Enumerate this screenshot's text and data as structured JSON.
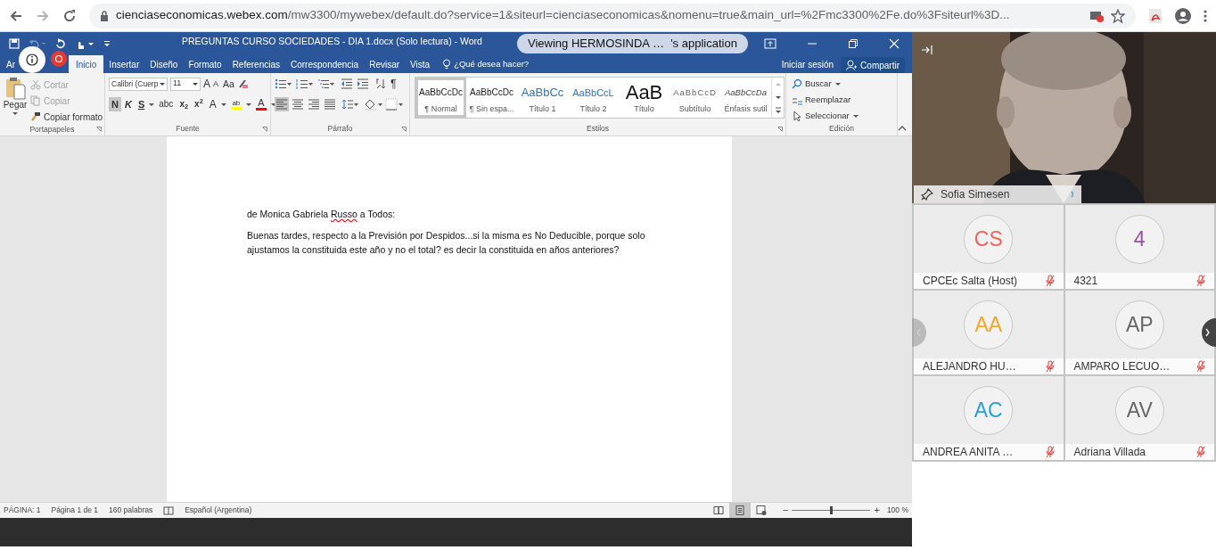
{
  "browser": {
    "host": "cienciaseconomicas.webex.com",
    "path": "/mw3300/mywebex/default.do?service=1&siteurl=cienciaseconomicas&nomenu=true&main_url=%2Fmc3300%2Fe.do%3Fsiteurl%3D..."
  },
  "word": {
    "title": "PREGUNTAS CURSO SOCIEDADES - DIA 1.docx (Solo lectura) - Word",
    "tabs": [
      {
        "label": "Ar",
        "selected": false
      },
      {
        "label": "Inicio",
        "selected": true
      },
      {
        "label": "Insertar",
        "selected": false
      },
      {
        "label": "Diseño",
        "selected": false
      },
      {
        "label": "Formato",
        "selected": false
      },
      {
        "label": "Referencias",
        "selected": false
      },
      {
        "label": "Correspondencia",
        "selected": false
      },
      {
        "label": "Revisar",
        "selected": false
      },
      {
        "label": "Vista",
        "selected": false
      }
    ],
    "tell_me": "¿Qué desea hacer?",
    "account": "Iniciar sesión",
    "share": "Compartir",
    "clipboard": {
      "group": "Portapapeles",
      "paste": "Pegar",
      "items": [
        {
          "kind": "cut",
          "label": "Cortar",
          "disabled": true
        },
        {
          "kind": "copy",
          "label": "Copiar",
          "disabled": true
        },
        {
          "kind": "painter",
          "label": "Copiar formato",
          "disabled": false
        }
      ]
    },
    "font": {
      "group": "Fuente",
      "name": "Calibri (Cuerp",
      "size": "11",
      "grow": "A",
      "shrink": "A",
      "case": "Aa",
      "tools": [
        {
          "kind": "bold",
          "label": "N",
          "selected": true
        },
        {
          "kind": "italic",
          "label": "K",
          "selected": false
        },
        {
          "kind": "underline",
          "label": "S",
          "selected": false
        },
        {
          "kind": "strike",
          "label": "abc",
          "selected": false
        },
        {
          "kind": "subscript",
          "label": "x$_{2}$",
          "selected": false
        },
        {
          "kind": "superscript",
          "label": "x$^{2}$",
          "selected": false
        },
        {
          "kind": "effects",
          "label": "A",
          "selected": false
        },
        {
          "kind": "highlight",
          "label": "ab",
          "selected": false
        },
        {
          "kind": "color",
          "label": "A",
          "selected": false
        }
      ]
    },
    "paragraph": {
      "group": "Párrafo",
      "marks": "¶",
      "align": [
        {
          "kind": "left",
          "selected": true
        },
        {
          "kind": "center",
          "selected": false
        },
        {
          "kind": "right",
          "selected": false
        },
        {
          "kind": "justify",
          "selected": false
        }
      ]
    },
    "styles": {
      "group": "Estilos",
      "items": [
        {
          "kind": "normal",
          "sample": "AaBbCcDc",
          "label": "¶ Normal",
          "selected": true
        },
        {
          "kind": "nospacing",
          "sample": "AaBbCcDc",
          "label": "¶ Sin espa...",
          "selected": false
        },
        {
          "kind": "heading1",
          "sample": "AaBbCc",
          "label": "Título 1",
          "selected": false
        },
        {
          "kind": "heading2",
          "sample": "AaBbCcL",
          "label": "Título 2",
          "selected": false
        },
        {
          "kind": "title",
          "sample": "AaB",
          "label": "Título",
          "selected": false
        },
        {
          "kind": "subtitle",
          "sample": "AaBbCcD",
          "label": "Subtítulo",
          "selected": false
        },
        {
          "kind": "emphasis",
          "sample": "AaBbCcDa",
          "label": "Énfasis sutil",
          "selected": false
        }
      ]
    },
    "editing": {
      "group": "Edición",
      "items": [
        {
          "kind": "find",
          "label": "Buscar"
        },
        {
          "kind": "replace",
          "label": "Reemplazar"
        },
        {
          "kind": "select",
          "label": "Seleccionar"
        }
      ]
    },
    "document": {
      "sender_before": "de Monica Gabriela ",
      "sender_flagged": "Russo",
      "sender_after": " a Todos:",
      "body": "Buenas tardes, respecto a la Previsión por Despidos...si la misma es No Deducible, porque solo ajustamos la constituida este año y no el total? es decir la constituida en años anteriores?"
    },
    "status": {
      "page": "PÁGINA: 1",
      "pages": "Página 1 de 1",
      "words": "160 palabras",
      "language": "Español (Argentina)",
      "views": [
        {
          "kind": "read",
          "selected": false
        },
        {
          "kind": "print",
          "selected": true
        },
        {
          "kind": "web",
          "selected": false
        }
      ],
      "zoom": {
        "minus": "−",
        "plus": "+",
        "level": 0.5,
        "reading": "100 %"
      }
    }
  },
  "webex": {
    "banner": "Viewing HERMOSINDA …  's application",
    "speaker": {
      "name": "Sofia Simesen"
    },
    "participants": [
      {
        "initials": "CS",
        "color": "#f0645a",
        "name": "CPCEc Salta (Host)",
        "muted": true
      },
      {
        "initials": "4",
        "color": "#9b4fa8",
        "name": "4321",
        "muted": true
      },
      {
        "initials": "AA",
        "color": "#f5a623",
        "name": "ALEJANDRO HU…",
        "muted": true
      },
      {
        "initials": "AP",
        "color": "#666666",
        "name": "AMPARO LECUO…",
        "muted": true
      },
      {
        "initials": "AC",
        "color": "#2a9fd8",
        "name": "ANDREA ANITA …",
        "muted": true
      },
      {
        "initials": "AV",
        "color": "#666666",
        "name": "Adriana Villada",
        "muted": true
      }
    ]
  }
}
